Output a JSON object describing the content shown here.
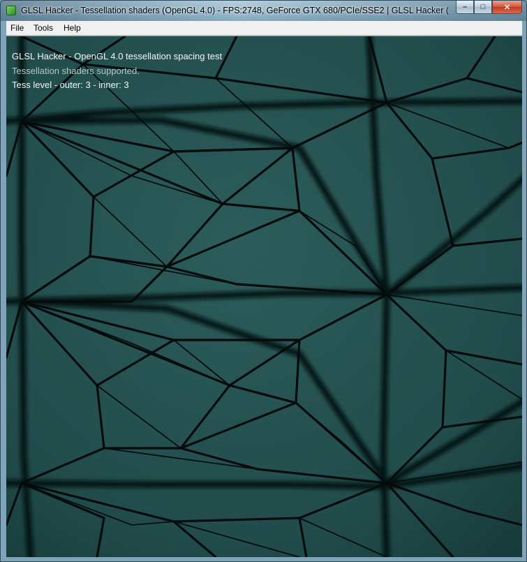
{
  "window": {
    "title": "GLSL Hacker - Tessellation shaders (OpenGL 4.0) - FPS:2748, GeForce GTX 680/PCIe/SSE2 | GLSL Hacker (Windows...",
    "buttons": {
      "minimize": "–",
      "maximize": "□",
      "close": "✕"
    }
  },
  "menu": {
    "items": [
      "File",
      "Tools",
      "Help"
    ]
  },
  "overlay": {
    "line1": "GLSL Hacker - OpenGL 4.0 tessellation spacing test",
    "line2": "Tessellation shaders supported.",
    "line3": "Tess level - outer: 3 - inner: 3"
  },
  "colors": {
    "surface": "#23504f",
    "wire": "#060b0b",
    "text": "#f4f7f7"
  }
}
